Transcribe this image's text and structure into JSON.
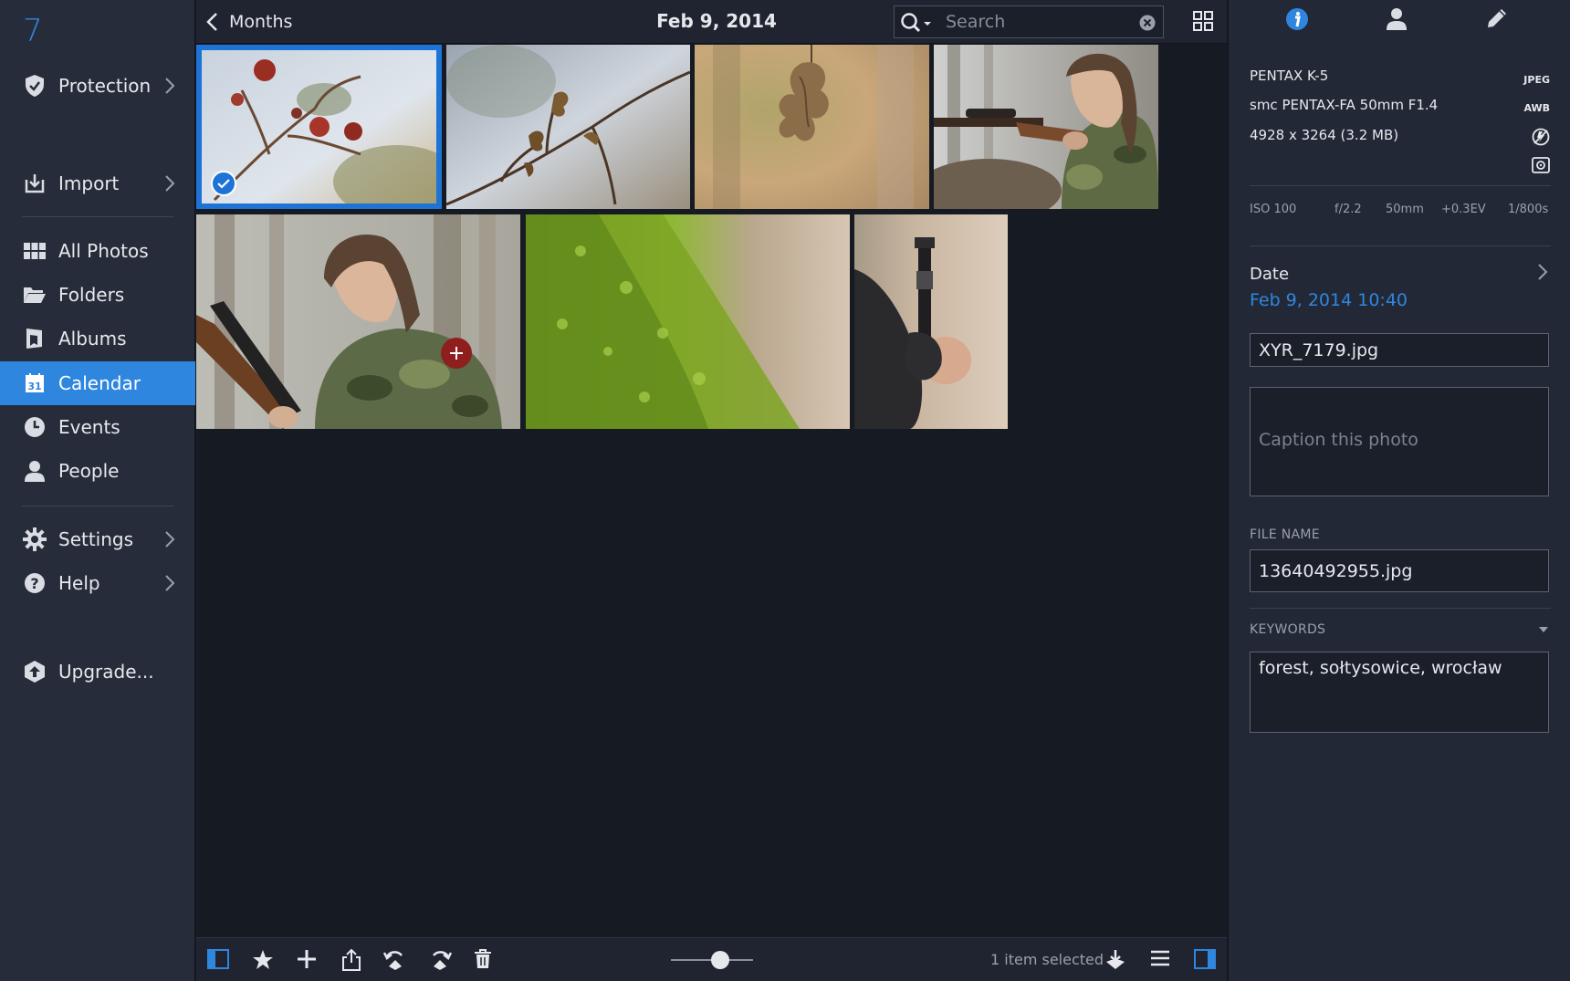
{
  "sidebar": {
    "logo": "7",
    "items": [
      {
        "label": "Protection",
        "icon": "shield-icon"
      },
      {
        "label": "Import",
        "icon": "import-icon"
      },
      {
        "label": "All Photos",
        "icon": "grid-icon"
      },
      {
        "label": "Folders",
        "icon": "folder-icon"
      },
      {
        "label": "Albums",
        "icon": "album-icon"
      },
      {
        "label": "Calendar",
        "icon": "calendar-icon",
        "badge": "31"
      },
      {
        "label": "Events",
        "icon": "clock-icon"
      },
      {
        "label": "People",
        "icon": "person-icon"
      },
      {
        "label": "Settings",
        "icon": "gear-icon"
      },
      {
        "label": "Help",
        "icon": "help-icon"
      },
      {
        "label": "Upgrade...",
        "icon": "upgrade-icon"
      }
    ],
    "active": "Calendar"
  },
  "topbar": {
    "back_label": "Months",
    "title": "Feb 9, 2014",
    "search_placeholder": "Search"
  },
  "photos": [
    {
      "subject": "rosehips",
      "selected": true
    },
    {
      "subject": "dry-leaves-branch",
      "selected": false
    },
    {
      "subject": "dry-leaf",
      "selected": false
    },
    {
      "subject": "person-aiming-rifle",
      "selected": false
    },
    {
      "subject": "person-holding-rifle",
      "selected": false
    },
    {
      "subject": "moss",
      "selected": false
    },
    {
      "subject": "rifle-barrel-glove",
      "selected": false
    }
  ],
  "bottombar": {
    "selected_text": "1 item selected",
    "zoom_level": 0.6
  },
  "info_panel": {
    "camera": "PENTAX K-5",
    "lens": "smc PENTAX-FA 50mm F1.4",
    "dimensions": "4928 x 3264 (3.2 MB)",
    "format_badge": "JPEG",
    "wb_badge": "AWB",
    "exif": {
      "iso": "ISO 100",
      "aperture": "f/2.2",
      "focal": "50mm",
      "ev": "+0.3EV",
      "shutter": "1/800s"
    },
    "date_label": "Date",
    "date_value": "Feb 9, 2014 10:40",
    "title_value": "XYR_7179.jpg",
    "caption_placeholder": "Caption this photo",
    "file_name_label": "FILE NAME",
    "file_name_value": "13640492955.jpg",
    "keywords_label": "KEYWORDS",
    "keywords_value": "forest, sołtysowice, wrocław"
  },
  "colors": {
    "accent": "#2f86de",
    "selection": "#1e73d6",
    "sidebar_bg": "#262c39",
    "grid_bg": "#161a23"
  }
}
